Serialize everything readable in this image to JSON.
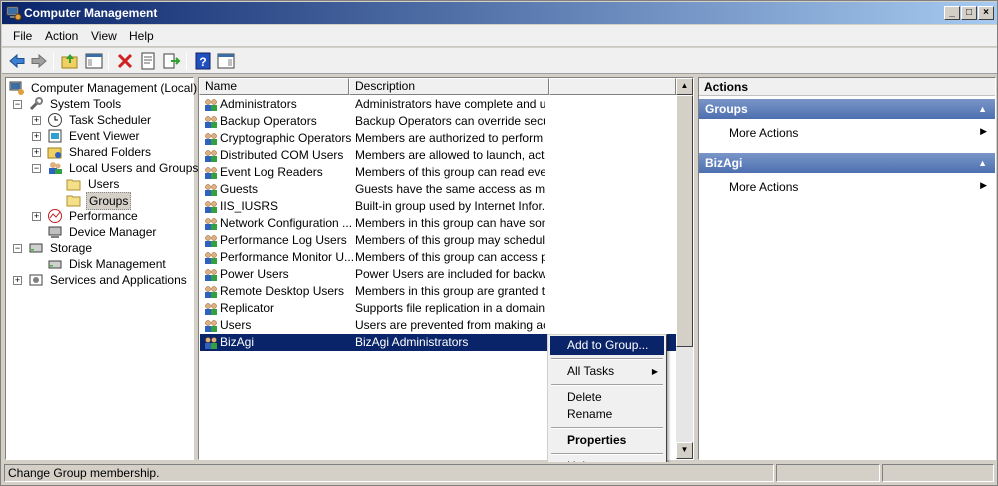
{
  "window": {
    "title": "Computer Management"
  },
  "menu": [
    "File",
    "Action",
    "View",
    "Help"
  ],
  "tree": {
    "root": "Computer Management (Local)",
    "system_tools": "System Tools",
    "task_scheduler": "Task Scheduler",
    "event_viewer": "Event Viewer",
    "shared_folders": "Shared Folders",
    "local_users_groups": "Local Users and Groups",
    "users": "Users",
    "groups": "Groups",
    "performance": "Performance",
    "device_manager": "Device Manager",
    "storage": "Storage",
    "disk_management": "Disk Management",
    "services_apps": "Services and Applications"
  },
  "list": {
    "headers": [
      "Name",
      "Description"
    ],
    "rows": [
      {
        "name": "Administrators",
        "desc": "Administrators have complete and u..."
      },
      {
        "name": "Backup Operators",
        "desc": "Backup Operators can override secu..."
      },
      {
        "name": "Cryptographic Operators",
        "desc": "Members are authorized to perform ..."
      },
      {
        "name": "Distributed COM Users",
        "desc": "Members are allowed to launch, acti..."
      },
      {
        "name": "Event Log Readers",
        "desc": "Members of this group can read eve..."
      },
      {
        "name": "Guests",
        "desc": "Guests have the same access as me..."
      },
      {
        "name": "IIS_IUSRS",
        "desc": "Built-in group used by Internet Infor..."
      },
      {
        "name": "Network Configuration ...",
        "desc": "Members in this group can have som..."
      },
      {
        "name": "Performance Log Users",
        "desc": "Members of this group may schedule..."
      },
      {
        "name": "Performance Monitor U...",
        "desc": "Members of this group can access p..."
      },
      {
        "name": "Power Users",
        "desc": "Power Users are included for backw..."
      },
      {
        "name": "Remote Desktop Users",
        "desc": "Members in this group are granted t..."
      },
      {
        "name": "Replicator",
        "desc": "Supports file replication in a domain"
      },
      {
        "name": "Users",
        "desc": "Users are prevented from making ac..."
      },
      {
        "name": "BizAgi",
        "desc": "BizAgi Administrators"
      }
    ]
  },
  "actions": {
    "title": "Actions",
    "section1": "Groups",
    "section1_item": "More Actions",
    "section2": "BizAgi",
    "section2_item": "More Actions"
  },
  "context_menu": {
    "add_to_group": "Add to Group...",
    "all_tasks": "All Tasks",
    "delete": "Delete",
    "rename": "Rename",
    "properties": "Properties",
    "help": "Help"
  },
  "status": {
    "text": "Change Group membership."
  },
  "colors": {
    "selection": "#0a246a",
    "title_start": "#0a246a",
    "action_header": "#4d6fb0"
  }
}
